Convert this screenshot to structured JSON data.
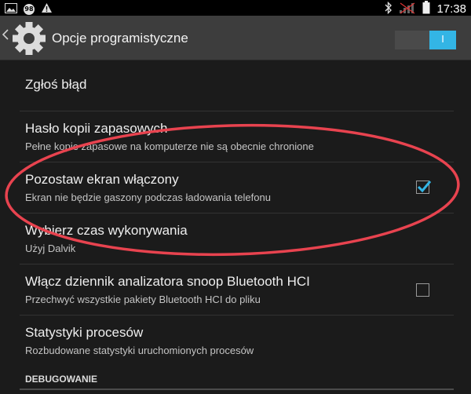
{
  "status_bar": {
    "notification_badge": "98",
    "time": "17:38",
    "icons": [
      "image-icon",
      "badge-icon",
      "warning-icon",
      "bluetooth-icon",
      "signal-icon",
      "battery-icon"
    ]
  },
  "action_bar": {
    "title": "Opcje programistyczne",
    "icon": "gear-icon",
    "switch_state": "on",
    "switch_label": "I"
  },
  "settings": [
    {
      "title": "Zgłoś błąd"
    },
    {
      "title": "Hasło kopii zapasowych",
      "summary": "Pełne kopie zapasowe na komputerze nie są obecnie chronione"
    },
    {
      "title": "Pozostaw ekran włączony",
      "summary": "Ekran nie będzie gaszony podczas ładowania telefonu",
      "checked": true
    },
    {
      "title": "Wybierz czas wykonywania",
      "summary": "Użyj Dalvik"
    },
    {
      "title": "Włącz dziennik analizatora snoop Bluetooth HCI",
      "summary": "Przechwyć wszystkie pakiety Bluetooth HCI do pliku",
      "checked": false
    },
    {
      "title": "Statystyki procesów",
      "summary": "Rozbudowane statystyki uruchomionych procesów"
    }
  ],
  "section_header": "DEBUGOWANIE",
  "colors": {
    "accent": "#33b5e5",
    "annotation": "#e8434f",
    "background": "#1b1b1b",
    "action_bar": "#3d3d3d"
  }
}
